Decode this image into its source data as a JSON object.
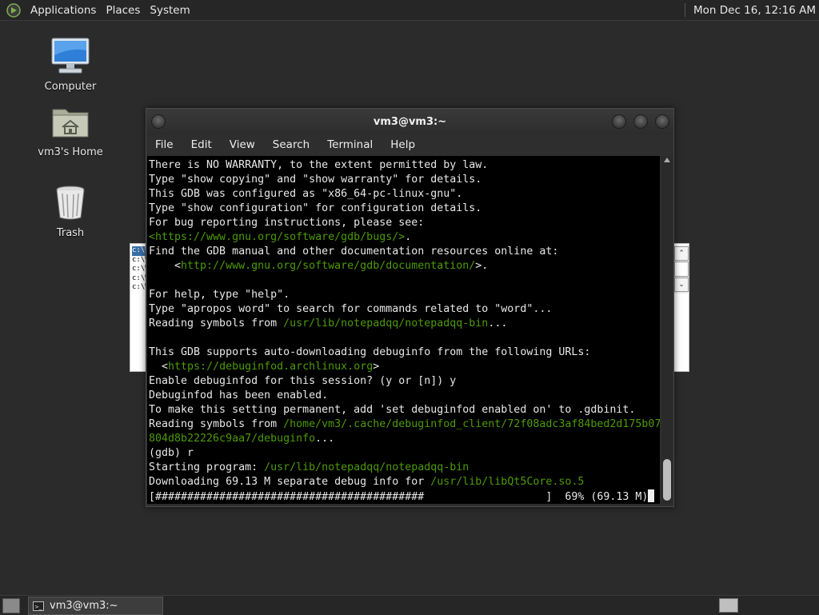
{
  "top_panel": {
    "menus": [
      "Applications",
      "Places",
      "System"
    ],
    "clock": "Mon Dec 16, 12:16 AM"
  },
  "desktop_icons": [
    {
      "label": "Computer",
      "icon": "computer-icon"
    },
    {
      "label": "vm3's Home",
      "icon": "home-folder-icon"
    },
    {
      "label": "Trash",
      "icon": "trash-icon"
    }
  ],
  "background_window": {
    "lines": [
      "c:\\W",
      "c:\\W",
      "c:\\W",
      "c:\\W",
      "c:\\W"
    ]
  },
  "terminal": {
    "title": "vm3@vm3:~",
    "menus": [
      "File",
      "Edit",
      "View",
      "Search",
      "Terminal",
      "Help"
    ],
    "lines": [
      [
        {
          "t": "There is NO WARRANTY, to the extent permitted by law."
        }
      ],
      [
        {
          "t": "Type \"show copying\" and \"show warranty\" for details."
        }
      ],
      [
        {
          "t": "This GDB was configured as \"x86_64-pc-linux-gnu\"."
        }
      ],
      [
        {
          "t": "Type \"show configuration\" for configuration details."
        }
      ],
      [
        {
          "t": "For bug reporting instructions, please see:"
        }
      ],
      [
        {
          "t": "<https://www.gnu.org/software/gdb/bugs/>",
          "c": "lnk"
        },
        {
          "t": "."
        }
      ],
      [
        {
          "t": "Find the GDB manual and other documentation resources online at:"
        }
      ],
      [
        {
          "t": "    <"
        },
        {
          "t": "http://www.gnu.org/software/gdb/documentation/",
          "c": "lnk"
        },
        {
          "t": ">."
        }
      ],
      [
        {
          "t": ""
        }
      ],
      [
        {
          "t": "For help, type \"help\"."
        }
      ],
      [
        {
          "t": "Type \"apropos word\" to search for commands related to \"word\"..."
        }
      ],
      [
        {
          "t": "Reading symbols from "
        },
        {
          "t": "/usr/lib/notepadqq/notepadqq-bin",
          "c": "lnk"
        },
        {
          "t": "..."
        }
      ],
      [
        {
          "t": ""
        }
      ],
      [
        {
          "t": "This GDB supports auto-downloading debuginfo from the following URLs:"
        }
      ],
      [
        {
          "t": "  <"
        },
        {
          "t": "https://debuginfod.archlinux.org",
          "c": "lnk"
        },
        {
          "t": ">"
        }
      ],
      [
        {
          "t": "Enable debuginfod for this session? (y or [n]) y"
        }
      ],
      [
        {
          "t": "Debuginfod has been enabled."
        }
      ],
      [
        {
          "t": "To make this setting permanent, add 'set debuginfod enabled on' to .gdbinit."
        }
      ],
      [
        {
          "t": "Reading symbols from "
        },
        {
          "t": "/home/vm3/.cache/debuginfod_client/72f08adc3af84bed2d175b07",
          "c": "lnk"
        }
      ],
      [
        {
          "t": "804d8b22226c9aa7/debuginfo",
          "c": "lnk"
        },
        {
          "t": "..."
        }
      ],
      [
        {
          "t": "(gdb) r"
        }
      ],
      [
        {
          "t": "Starting program: "
        },
        {
          "t": "/usr/lib/notepadqq/notepadqq-bin",
          "c": "lnk"
        }
      ],
      [
        {
          "t": "Downloading 69.13 M separate debug info for "
        },
        {
          "t": "/usr/lib/libQt5Core.so.5",
          "c": "lnk"
        }
      ],
      [
        {
          "t": "[##########################################                   ]  69% (69.13 M)"
        }
      ]
    ],
    "download_progress": 0.69
  },
  "taskbar": {
    "window_label": "vm3@vm3:~"
  },
  "colors": {
    "link": "#4e9a06",
    "terminal_bg": "#000000",
    "desktop_bg": "#2b2b2b"
  }
}
